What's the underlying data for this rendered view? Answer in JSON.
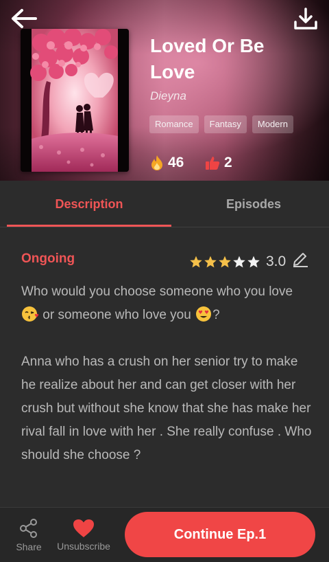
{
  "book": {
    "title": "Loved Or Be Love",
    "author": "Dieyna",
    "tags": [
      "Romance",
      "Fantasy",
      "Modern"
    ],
    "views": "46",
    "likes": "2"
  },
  "icons": {
    "back": "arrow-left-icon",
    "download": "download-icon",
    "views": "fire-icon",
    "likes": "thumbs-up-icon",
    "edit_rating": "pencil-icon",
    "share": "share-icon",
    "unsubscribe": "heart-icon"
  },
  "tabs": [
    {
      "label": "Description",
      "active": true
    },
    {
      "label": "Episodes",
      "active": false
    }
  ],
  "details": {
    "status": "Ongoing",
    "rating": "3.0",
    "stars_filled": 3,
    "stars_total": 5
  },
  "synopsis": {
    "line1_a": "Who would you choose someone who you love ",
    "line1_b": " or someone who love you ",
    "line1_c": "?",
    "para2": "Anna who has a crush on her senior try to make he realize about her and can get closer with her crush but without she know that she has make her rival fall in love with her . She really confuse . Who should she choose ?"
  },
  "bottom_bar": {
    "share_label": "Share",
    "unsubscribe_label": "Unsubscribe",
    "continue_label": "Continue Ep.1"
  },
  "colors": {
    "accent": "#f05556",
    "button": "#f04646",
    "star": "#f5c04a",
    "fire": "#f5a623",
    "thumb": "#ef4444"
  }
}
